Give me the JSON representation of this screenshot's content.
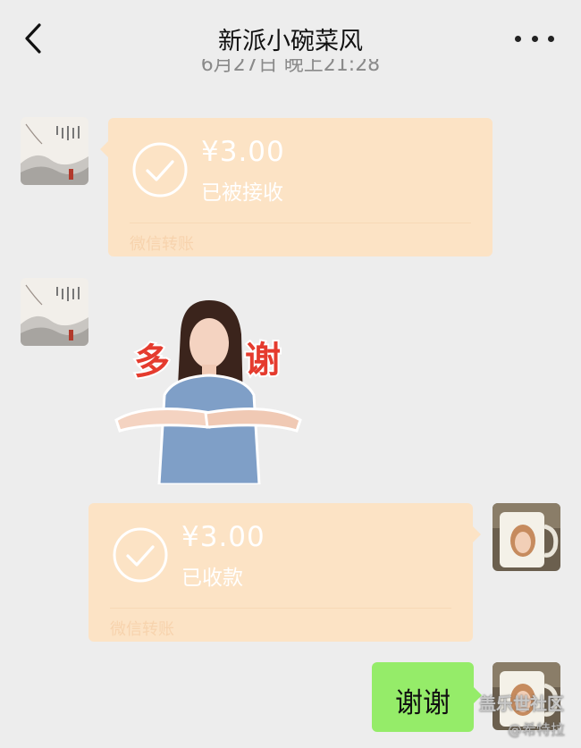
{
  "header": {
    "title": "新派小碗菜风",
    "back_icon": "chevron-left-icon",
    "more_icon": "more-dots-icon",
    "timestamp": "6月27日 晚上21:28"
  },
  "messages": [
    {
      "type": "transfer",
      "side": "left",
      "amount": "¥3.00",
      "status": "已被接收",
      "footer": "微信转账",
      "icon": "check-circle-icon"
    },
    {
      "type": "sticker",
      "side": "left",
      "sticker_text": "多谢"
    },
    {
      "type": "transfer",
      "side": "right",
      "amount": "¥3.00",
      "status": "已收款",
      "footer": "微信转账",
      "icon": "check-circle-icon"
    },
    {
      "type": "text",
      "side": "right",
      "text": "谢谢"
    }
  ],
  "watermark": {
    "line1": "盖乐世社区",
    "line2": "@希特拉"
  },
  "colors": {
    "background": "#ededed",
    "transfer_bubble": "#fce3c5",
    "text_bubble": "#95ec69"
  }
}
